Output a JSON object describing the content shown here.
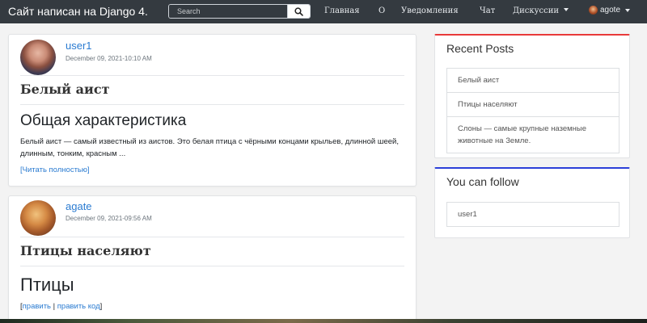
{
  "navbar": {
    "brand": "Сайт написан на Django 4.",
    "search_placeholder": "Search",
    "links": [
      "Главная",
      "О",
      "Уведомления",
      "Чат",
      "Дискуссии"
    ],
    "user": "agote"
  },
  "posts": [
    {
      "author": "user1",
      "date": "December 09, 2021-10:10 AM",
      "title": "Белый аист",
      "heading": "Общая характеристика",
      "body": "Белый аист — самый известный из аистов. Это белая птица с чёрными концами крыльев, длинной шеей, длинным, тонким, красным ...",
      "link": "[Читать полностью]"
    },
    {
      "author": "agate",
      "date": "December 09, 2021-09:56 AM",
      "title": "Птицы населяют",
      "heading": "Птицы",
      "links": {
        "open": "[",
        "edit": "править",
        "sep": "|",
        "edit_code": "править код",
        "close": "]"
      }
    }
  ],
  "recent_posts": {
    "title": "Recent Posts",
    "accent_color": "#e83a3a",
    "items": [
      "Белый аист",
      "Птицы населяют",
      "Слоны — самые крупные наземные животные на Земле."
    ]
  },
  "you_can_follow": {
    "title": "You can follow",
    "accent_color": "#2b3fd8",
    "items": [
      "user1"
    ]
  }
}
